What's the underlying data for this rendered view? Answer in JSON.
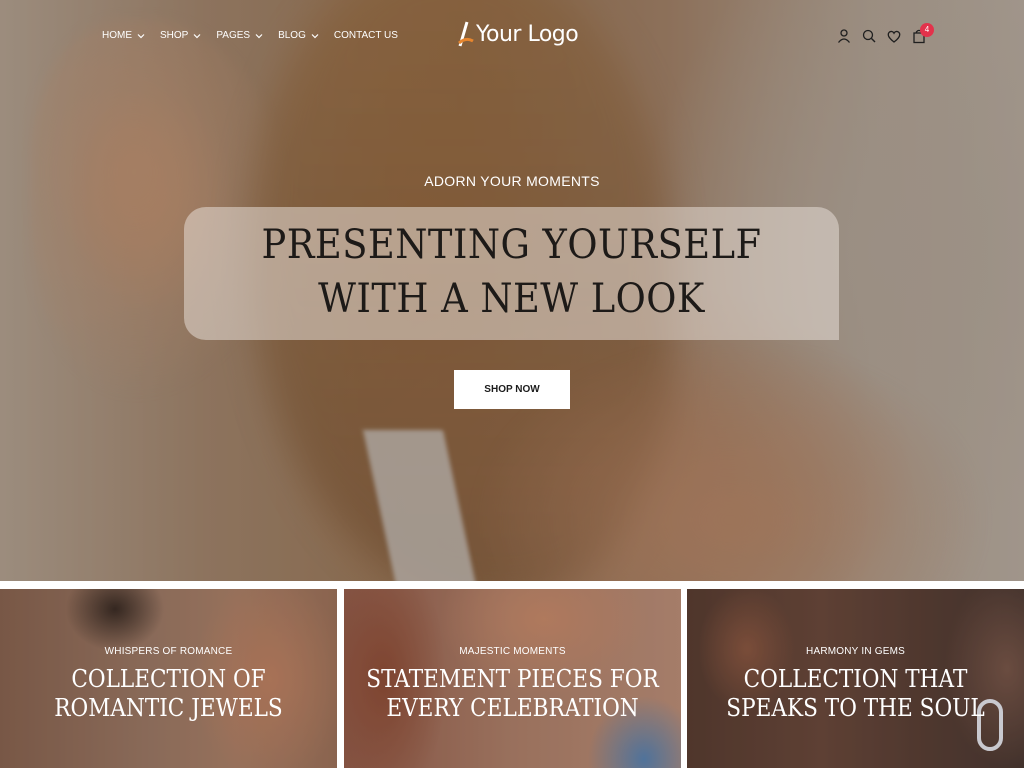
{
  "nav": {
    "items": [
      {
        "label": "HOME",
        "has_dropdown": true
      },
      {
        "label": "SHOP",
        "has_dropdown": true
      },
      {
        "label": "PAGES",
        "has_dropdown": true
      },
      {
        "label": "BLOG",
        "has_dropdown": true
      },
      {
        "label": "CONTACT US",
        "has_dropdown": false
      }
    ]
  },
  "logo": {
    "text": "Your Logo"
  },
  "header_icons": [
    "user-icon",
    "search-icon",
    "heart-icon",
    "shopping-bag-icon"
  ],
  "cart": {
    "count": "4"
  },
  "hero": {
    "eyebrow": "ADORN YOUR MOMENTS",
    "title": "PRESENTING YOURSELF WITH A NEW LOOK",
    "cta_label": "SHOP NOW"
  },
  "collections": [
    {
      "subtitle": "WHISPERS OF ROMANCE",
      "title": "COLLECTION OF ROMANTIC JEWELS"
    },
    {
      "subtitle": "MAJESTIC MOMENTS",
      "title": "STATEMENT PIECES FOR EVERY CELEBRATION"
    },
    {
      "subtitle": "HARMONY IN GEMS",
      "title": "COLLECTION THAT SPEAKS TO THE SOUL"
    }
  ],
  "colors": {
    "badge": "#e3324b",
    "logo_accent": "#e8862e",
    "title_text": "#1d1a18"
  }
}
